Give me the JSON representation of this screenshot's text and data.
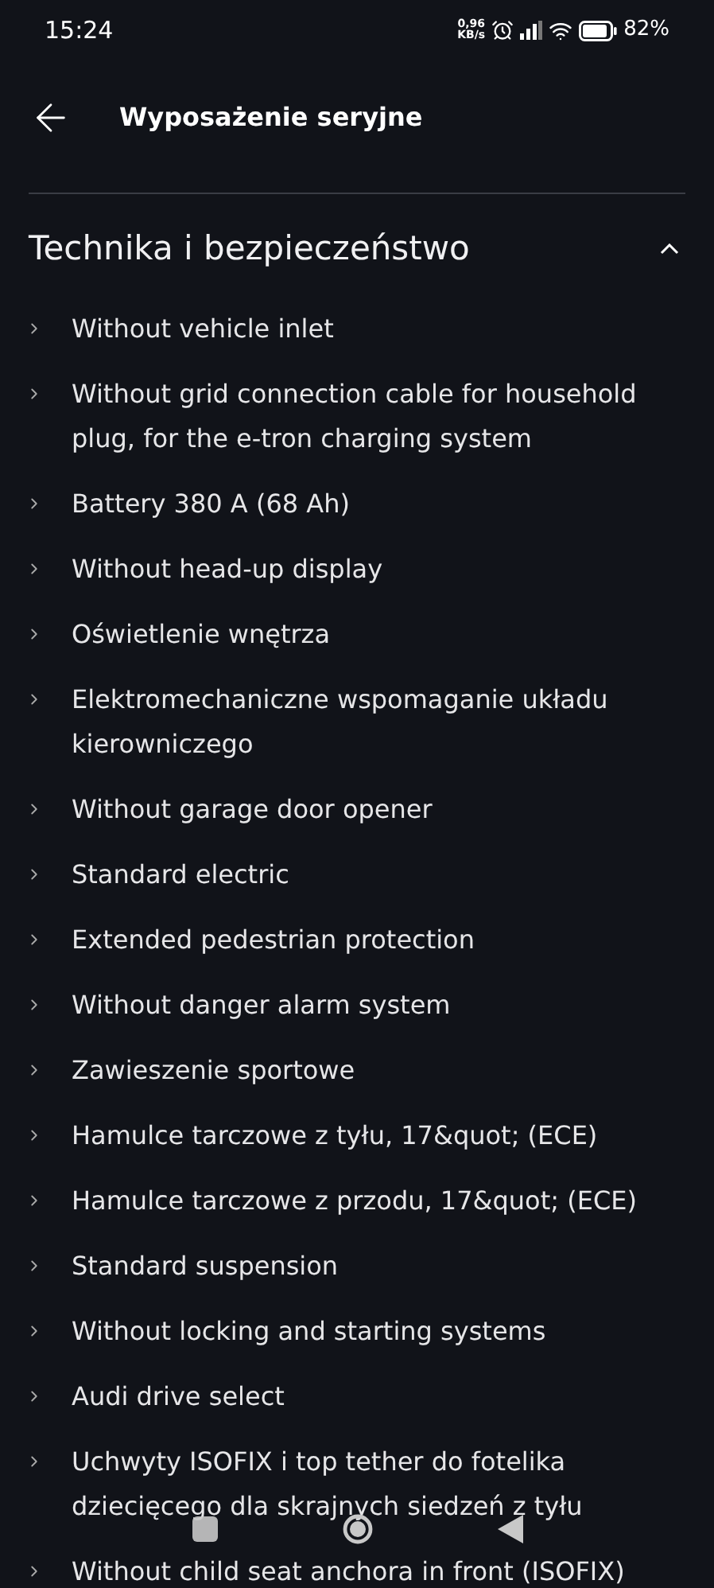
{
  "status_bar": {
    "time": "15:24",
    "speed": "0,96",
    "speed_unit": "KB/s",
    "battery": "82%"
  },
  "header": {
    "title": "Wyposażenie seryjne"
  },
  "section": {
    "title": "Technika i bezpieczeństwo",
    "expanded": true,
    "items": [
      "Without vehicle inlet",
      "Without grid connection cable for household plug, for the e-tron charging system",
      "Battery 380 A (68 Ah)",
      "Without head-up display",
      "Oświetlenie wnętrza",
      "Elektromechaniczne wspomaganie układu kierowniczego",
      "Without garage door opener",
      "Standard electric",
      "Extended pedestrian protection",
      "Without danger alarm system",
      "Zawieszenie sportowe",
      "Hamulce tarczowe z tyłu, 17&quot; (ECE)",
      "Hamulce tarczowe z przodu, 17&quot; (ECE)",
      "Standard suspension",
      "Without locking and starting systems",
      "Audi drive select",
      "Uchwyty ISOFIX i top tether do fotelika dziecięcego dla skrajnych siedzeń z tyłu",
      "Without child seat anchora in front (ISOFIX)"
    ]
  }
}
